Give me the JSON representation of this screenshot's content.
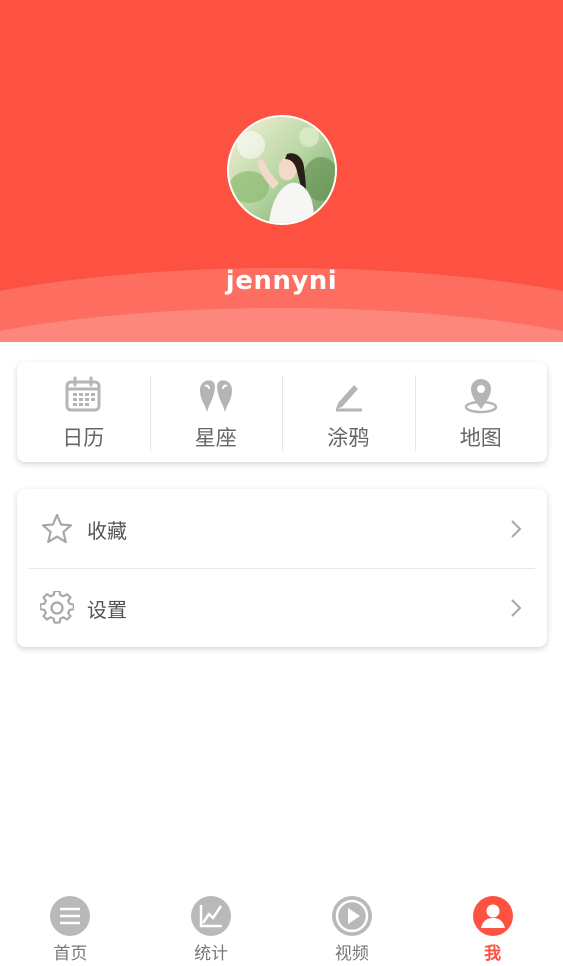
{
  "profile": {
    "username": "jennyni"
  },
  "features": [
    {
      "label": "日历",
      "icon": "calendar-icon"
    },
    {
      "label": "星座",
      "icon": "constellation-icon"
    },
    {
      "label": "涂鸦",
      "icon": "pencil-icon"
    },
    {
      "label": "地图",
      "icon": "map-pin-icon"
    }
  ],
  "menu": [
    {
      "label": "收藏",
      "icon": "star-icon"
    },
    {
      "label": "设置",
      "icon": "gear-icon"
    }
  ],
  "bottom_nav": [
    {
      "label": "首页",
      "icon": "list-icon",
      "active": false
    },
    {
      "label": "统计",
      "icon": "chart-icon",
      "active": false
    },
    {
      "label": "视频",
      "icon": "play-icon",
      "active": false
    },
    {
      "label": "我",
      "icon": "user-icon",
      "active": true
    }
  ],
  "colors": {
    "accent": "#fd5242",
    "icon_gray": "#b5b5b5",
    "text_gray": "#666666"
  }
}
